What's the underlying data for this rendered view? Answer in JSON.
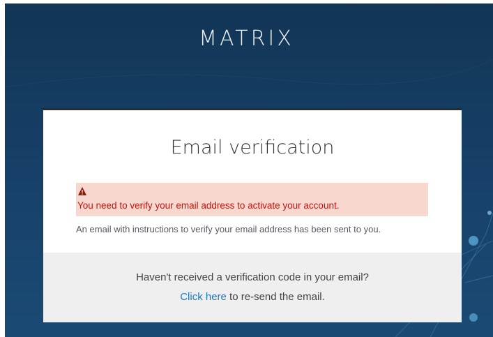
{
  "brand": "MATRIX",
  "card": {
    "title": "Email verification",
    "alert": {
      "icon": "warning-icon",
      "message": "You need to verify your email address to activate your account."
    },
    "info": "An email with instructions to verify your email address has been sent to you.",
    "footer": {
      "question": "Haven't received a verification code in your email?",
      "link": "Click here",
      "rest": " to re-send the email."
    }
  },
  "colors": {
    "background": "#163f66",
    "alert_bg": "#f8d7cf",
    "alert_text": "#c0160e",
    "link": "#1a7cc8"
  }
}
